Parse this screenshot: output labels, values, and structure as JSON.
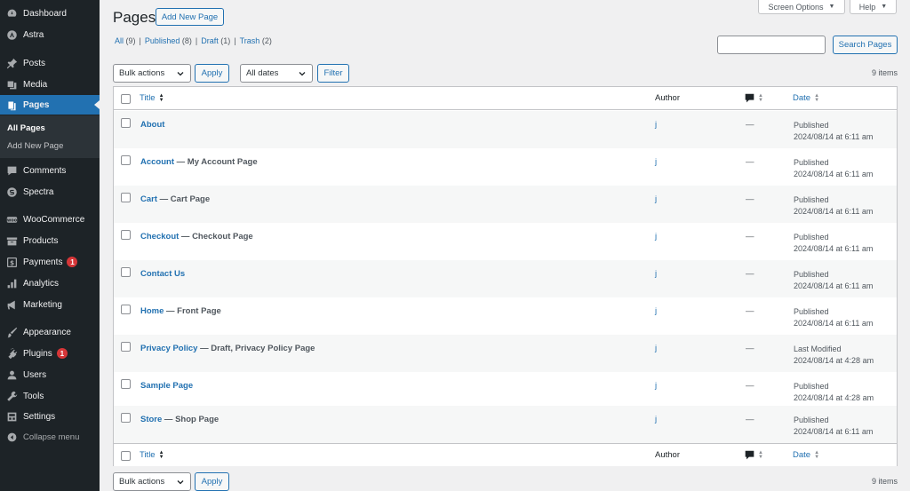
{
  "sidebar": {
    "items": [
      {
        "label": "Dashboard",
        "icon": "dashboard-icon"
      },
      {
        "label": "Astra",
        "icon": "astra-icon"
      },
      {
        "label": "Posts",
        "icon": "pin-icon"
      },
      {
        "label": "Media",
        "icon": "media-icon"
      },
      {
        "label": "Pages",
        "icon": "pages-icon",
        "active": true
      },
      {
        "label": "Comments",
        "icon": "comment-icon"
      },
      {
        "label": "Spectra",
        "icon": "spectra-icon"
      },
      {
        "label": "WooCommerce",
        "icon": "woo-icon"
      },
      {
        "label": "Products",
        "icon": "archive-icon"
      },
      {
        "label": "Payments",
        "icon": "dollar-icon",
        "badge": "1"
      },
      {
        "label": "Analytics",
        "icon": "chart-icon"
      },
      {
        "label": "Marketing",
        "icon": "megaphone-icon"
      },
      {
        "label": "Appearance",
        "icon": "brush-icon"
      },
      {
        "label": "Plugins",
        "icon": "plugin-icon",
        "badge": "1"
      },
      {
        "label": "Users",
        "icon": "user-icon"
      },
      {
        "label": "Tools",
        "icon": "wrench-icon"
      },
      {
        "label": "Settings",
        "icon": "settings-icon"
      }
    ],
    "submenu": {
      "all_pages": "All Pages",
      "add_new": "Add New Page"
    },
    "collapse": "Collapse menu"
  },
  "header": {
    "title": "Pages",
    "add_new": "Add New Page",
    "screen_options": "Screen Options",
    "help": "Help"
  },
  "views": [
    {
      "label": "All",
      "count": "(9)",
      "current": true
    },
    {
      "label": "Published",
      "count": "(8)"
    },
    {
      "label": "Draft",
      "count": "(1)"
    },
    {
      "label": "Trash",
      "count": "(2)"
    }
  ],
  "search": {
    "button": "Search Pages",
    "value": ""
  },
  "toolbar": {
    "bulk_actions": "Bulk actions",
    "apply": "Apply",
    "all_dates": "All dates",
    "filter": "Filter",
    "items_count": "9 items"
  },
  "table": {
    "columns": {
      "title": "Title",
      "author": "Author",
      "date": "Date"
    },
    "rows": [
      {
        "title": "About",
        "state": "",
        "author": "j",
        "comments": "—",
        "status": "Published",
        "date": "2024/08/14 at 6:11 am"
      },
      {
        "title": "Account",
        "state": " — My Account Page",
        "author": "j",
        "comments": "—",
        "status": "Published",
        "date": "2024/08/14 at 6:11 am"
      },
      {
        "title": "Cart",
        "state": " — Cart Page",
        "author": "j",
        "comments": "—",
        "status": "Published",
        "date": "2024/08/14 at 6:11 am"
      },
      {
        "title": "Checkout",
        "state": " — Checkout Page",
        "author": "j",
        "comments": "—",
        "status": "Published",
        "date": "2024/08/14 at 6:11 am"
      },
      {
        "title": "Contact Us",
        "state": "",
        "author": "j",
        "comments": "—",
        "status": "Published",
        "date": "2024/08/14 at 6:11 am"
      },
      {
        "title": "Home",
        "state": " — Front Page",
        "author": "j",
        "comments": "—",
        "status": "Published",
        "date": "2024/08/14 at 6:11 am"
      },
      {
        "title": "Privacy Policy",
        "state": " — Draft, Privacy Policy Page",
        "author": "j",
        "comments": "—",
        "status": "Last Modified",
        "date": "2024/08/14 at 4:28 am"
      },
      {
        "title": "Sample Page",
        "state": "",
        "author": "j",
        "comments": "—",
        "status": "Published",
        "date": "2024/08/14 at 4:28 am"
      },
      {
        "title": "Store",
        "state": " — Shop Page",
        "author": "j",
        "comments": "—",
        "status": "Published",
        "date": "2024/08/14 at 6:11 am"
      }
    ]
  },
  "colors": {
    "accent": "#2271b1",
    "sidebar_bg": "#1d2327",
    "badge": "#d63638"
  }
}
